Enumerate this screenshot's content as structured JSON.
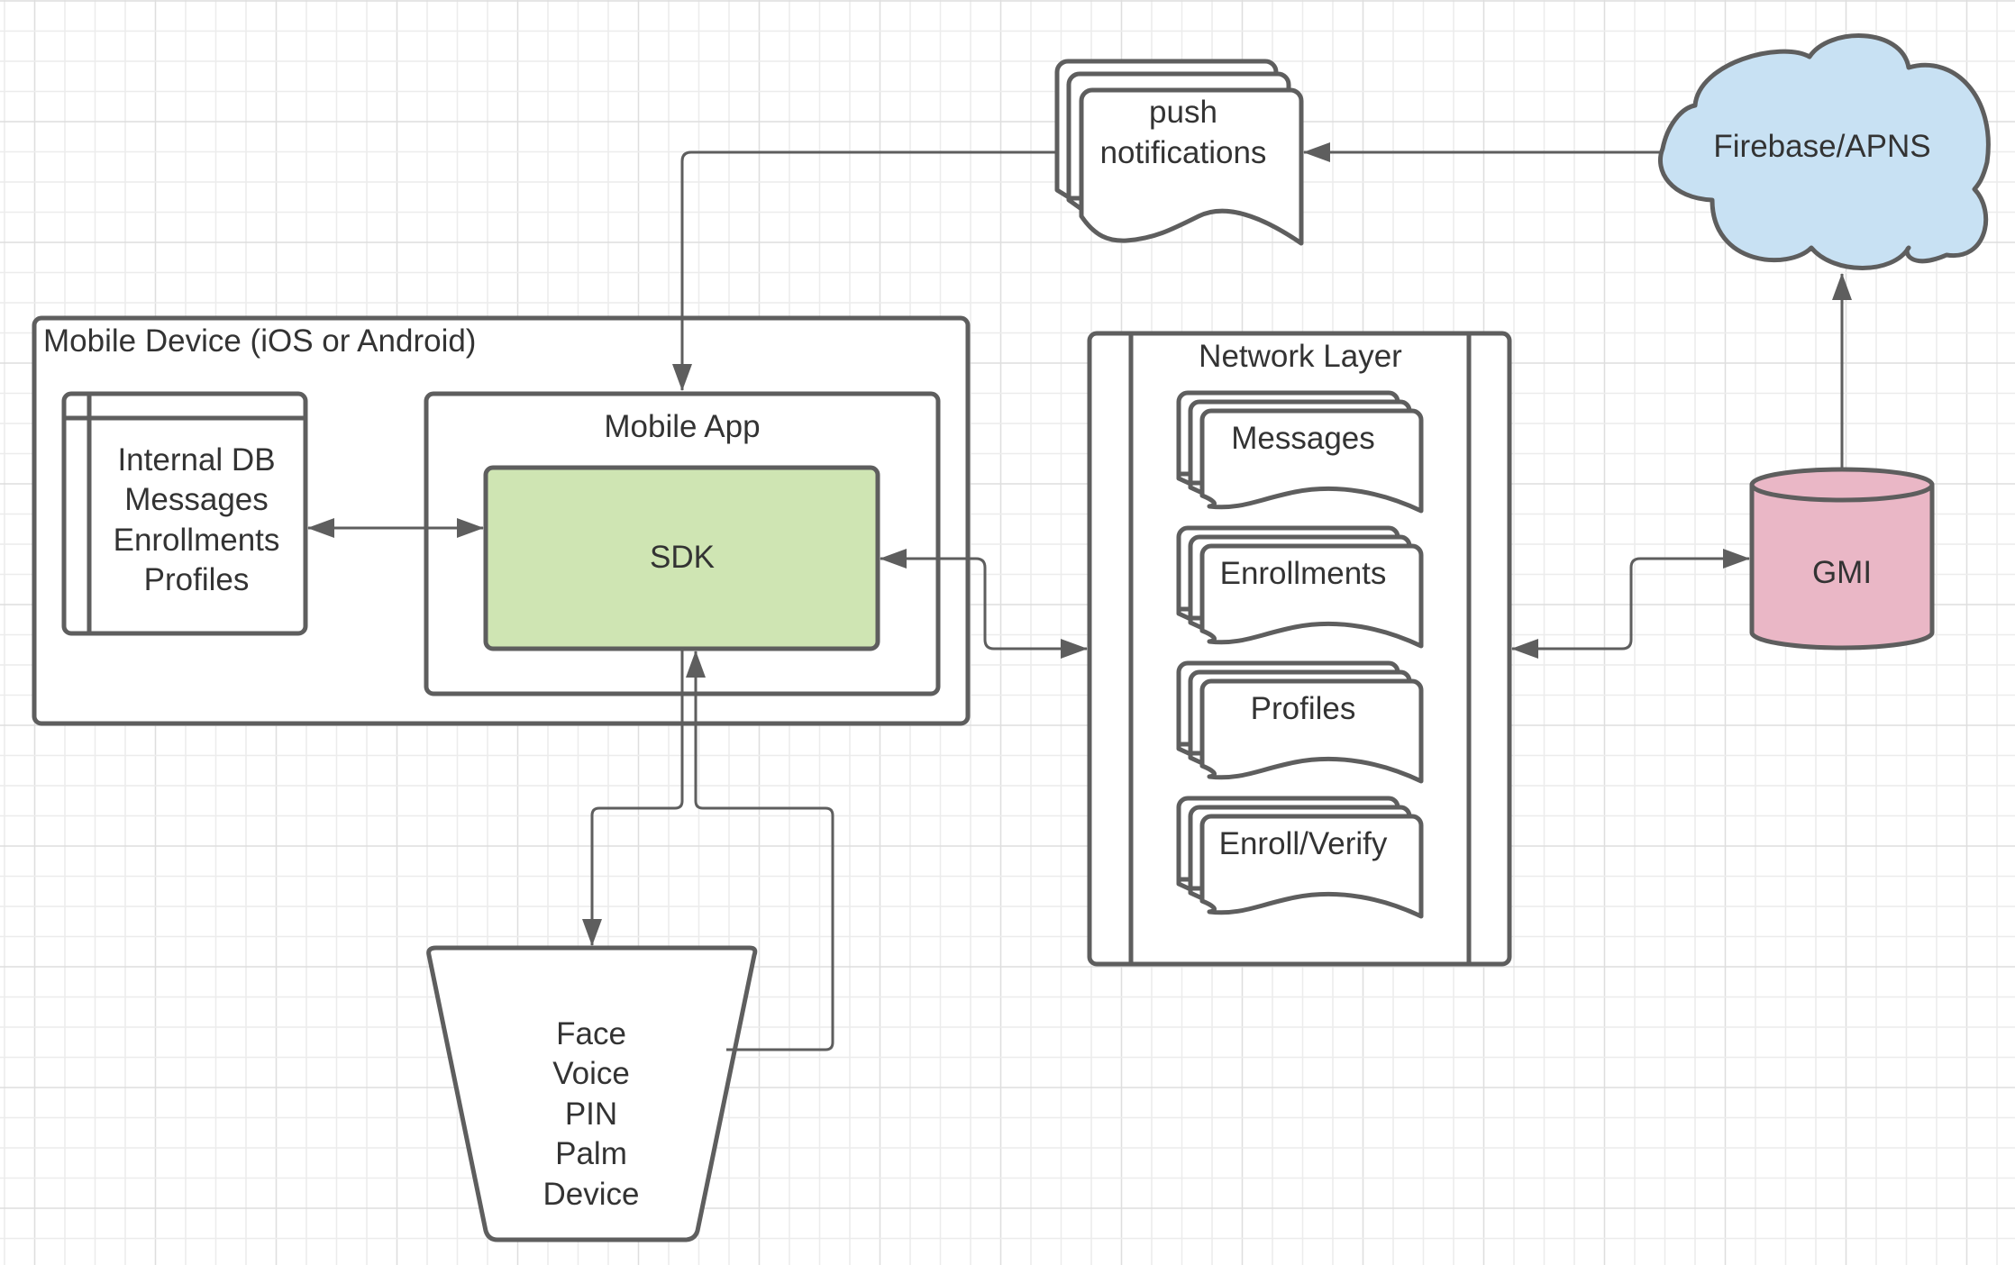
{
  "diagram": {
    "mobile_device": {
      "label": "Mobile Device (iOS or Android)"
    },
    "internal_db": {
      "lines": [
        "Internal DB",
        "Messages",
        "Enrollments",
        "Profiles"
      ]
    },
    "mobile_app": {
      "label": "Mobile App"
    },
    "sdk": {
      "label": "SDK",
      "fill": "#cfe5b3"
    },
    "push_notifications": {
      "lines": [
        "push",
        "notifications"
      ]
    },
    "firebase": {
      "label": "Firebase/APNS",
      "fill": "#c8e1f3"
    },
    "network_layer": {
      "label": "Network Layer",
      "documents": [
        {
          "label": "Messages"
        },
        {
          "label": "Enrollments"
        },
        {
          "label": "Profiles"
        },
        {
          "label": "Enroll/Verify"
        }
      ]
    },
    "gmi": {
      "label": "GMI",
      "fill": "#eab7c6"
    },
    "biometrics": {
      "lines": [
        "Face",
        "Voice",
        "PIN",
        "Palm",
        "Device"
      ]
    },
    "colors": {
      "stroke": "#5e5e5e",
      "text": "#333333",
      "grid": "#ececec"
    }
  }
}
